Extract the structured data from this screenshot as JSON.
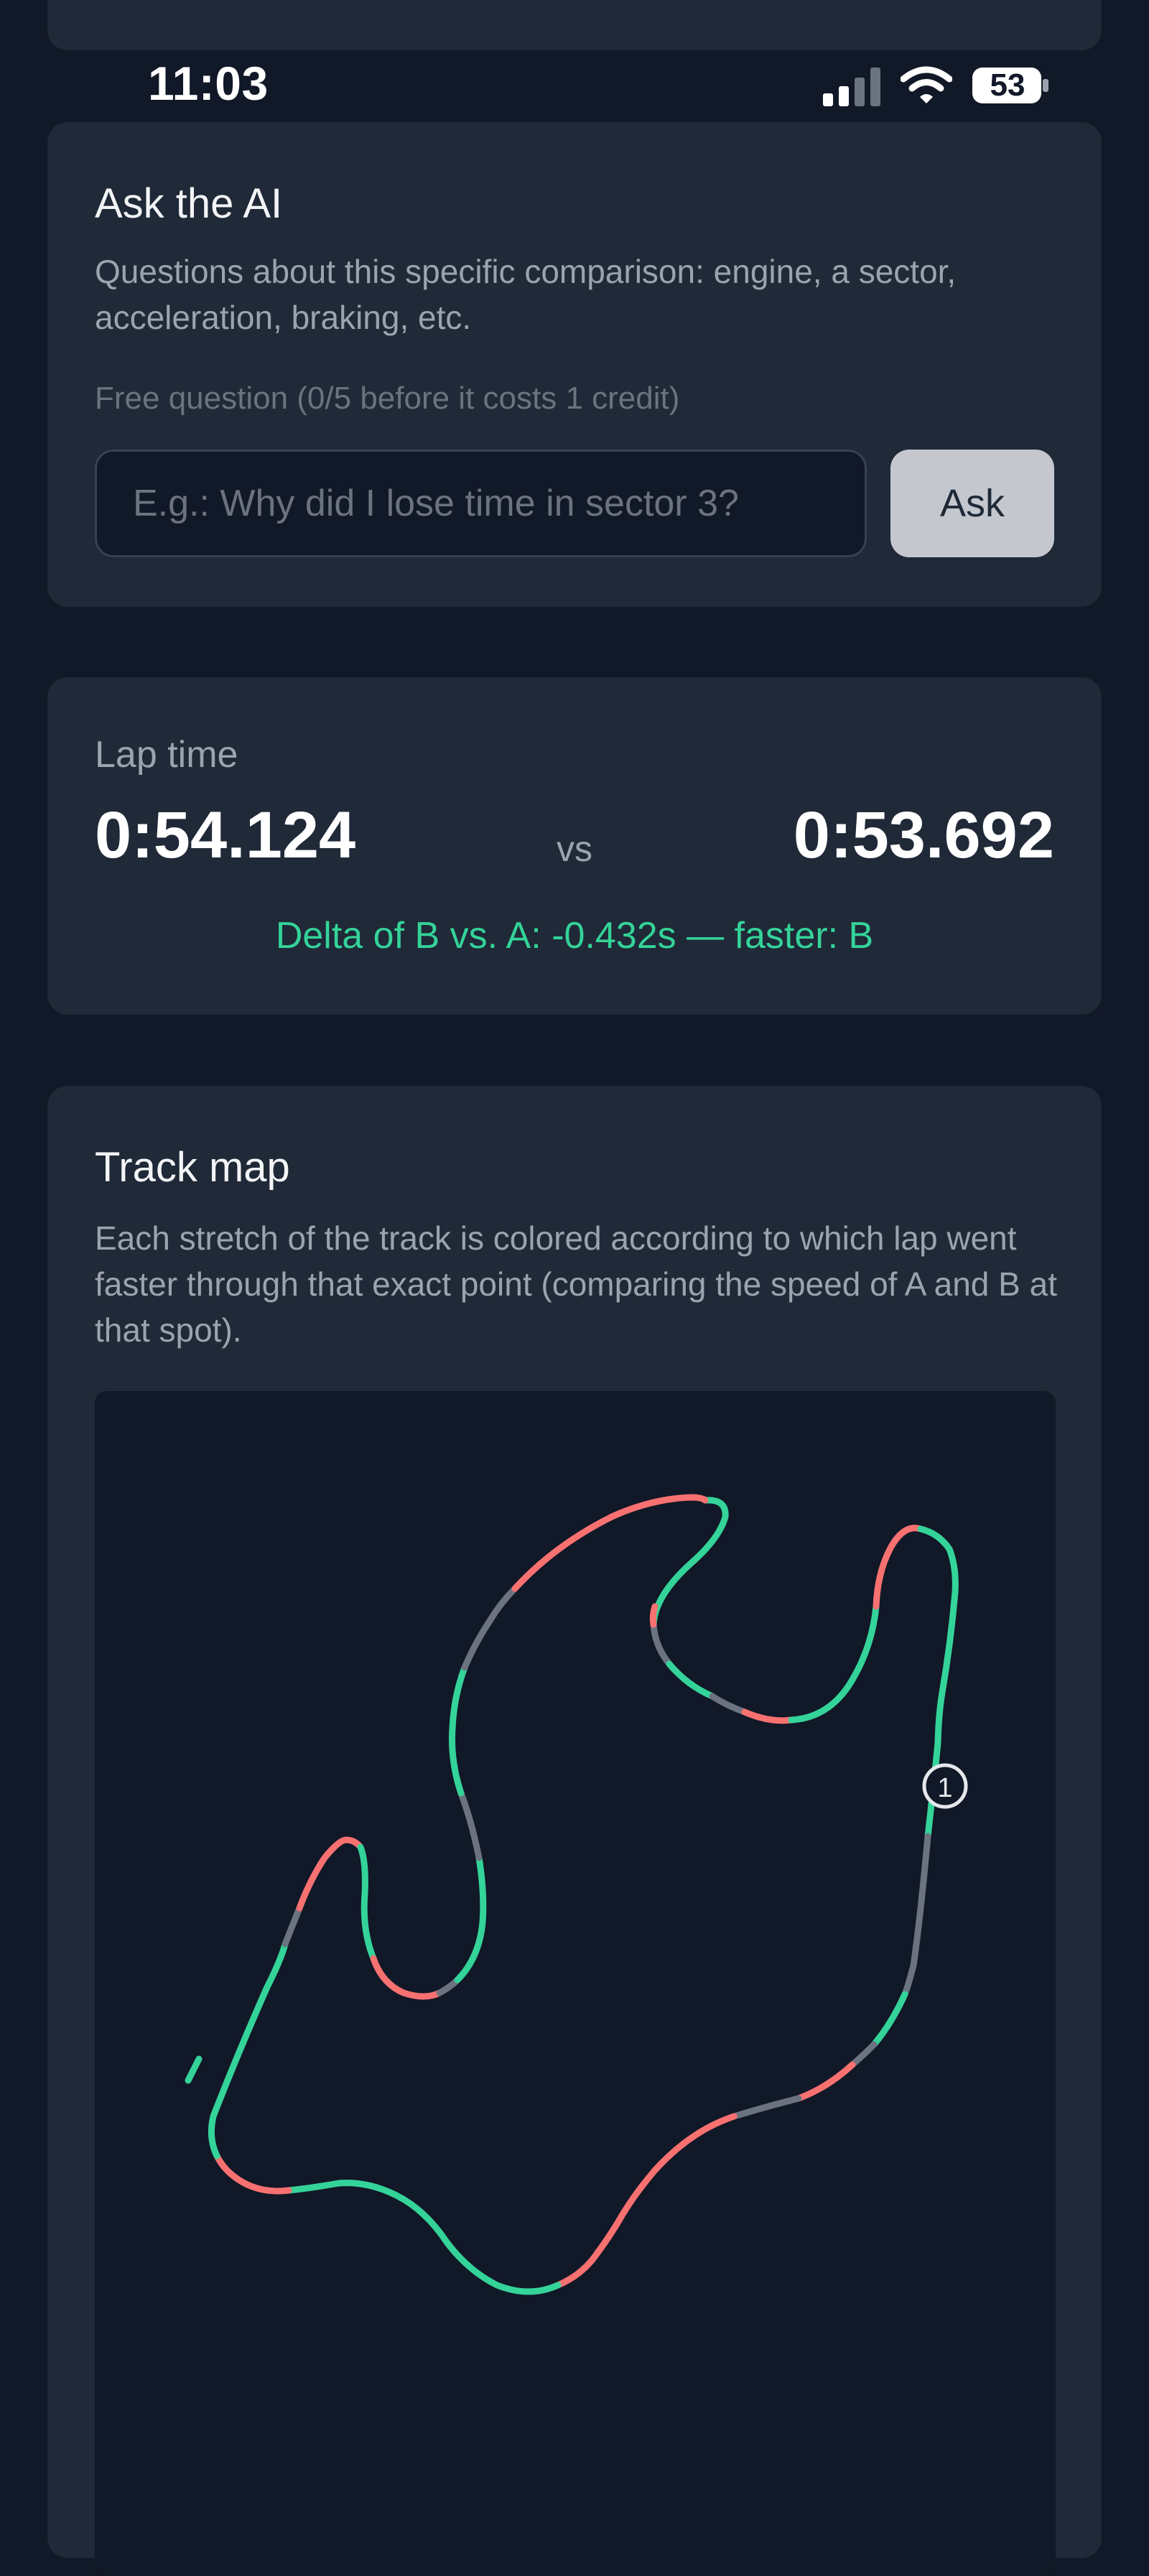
{
  "status_bar": {
    "time": "11:03",
    "battery": "53",
    "icons": [
      "signal-icon",
      "wifi-icon",
      "battery-icon"
    ]
  },
  "ask_ai": {
    "title": "Ask the AI",
    "description": "Questions about this specific comparison: engine, a sector, acceleration, braking, etc.",
    "free_note": "Free question (0/5 before it costs 1 credit)",
    "input_placeholder": "E.g.: Why did I lose time in sector 3?",
    "input_value": "",
    "ask_button_label": "Ask"
  },
  "lap_time": {
    "label": "Lap time",
    "lap_a": "0:54.124",
    "vs": "vs",
    "lap_b": "0:53.692",
    "delta_text": "Delta of B vs. A: -0.432s — faster: B"
  },
  "track_map": {
    "title": "Track map",
    "description": "Each stretch of the track is colored according to which lap went faster through that exact point (comparing the speed of A and B at that spot).",
    "start_marker": "1"
  },
  "colors": {
    "background": "#111827",
    "card": "#1f2937",
    "faster_b": "#34d399",
    "faster_a": "#f87171",
    "equal": "#6b7280",
    "ask_button": "#c4c8ce"
  }
}
